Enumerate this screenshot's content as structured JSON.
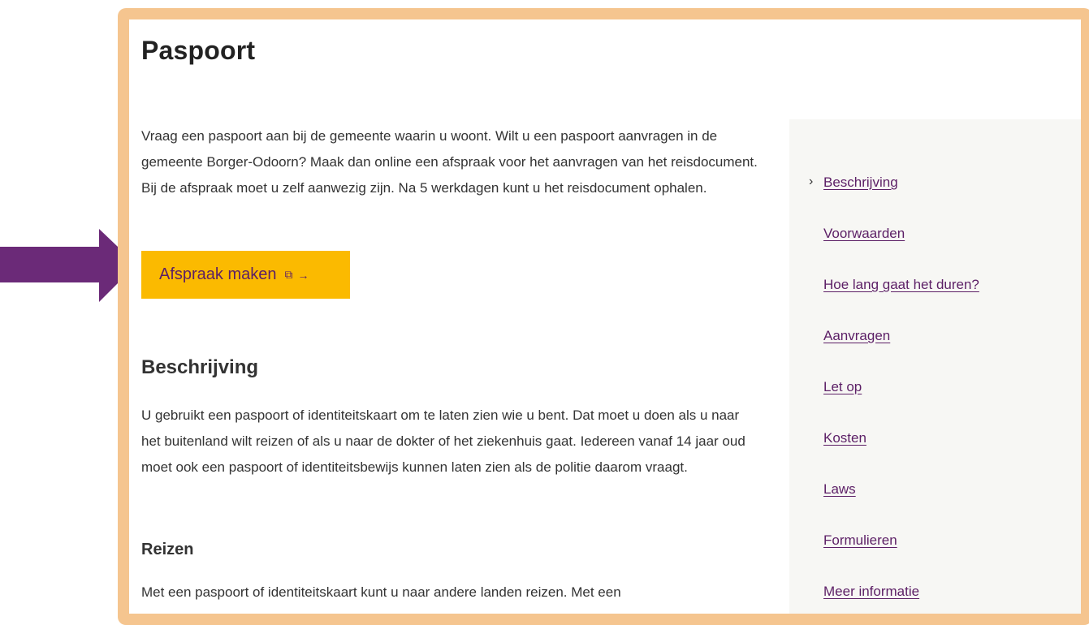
{
  "page": {
    "title": "Paspoort",
    "intro": "Vraag een paspoort aan bij de gemeente waarin u woont. Wilt u een paspoort aanvragen in de gemeente Borger-Odoorn? Maak dan online een afspraak voor het aanvragen van het reisdocument. Bij de afspraak moet u zelf aanwezig zijn. Na 5 werkdagen kunt u het reisdocument ophalen.",
    "cta_label": "Afspraak maken",
    "cta_icons": [
      "external-link-icon",
      "arrow-right-icon"
    ],
    "section_title": "Beschrijving",
    "section_text": "U gebruikt een paspoort of identiteitskaart om te laten zien wie u bent. Dat moet u doen als u naar het buitenland wilt reizen of als u naar de dokter of het ziekenhuis gaat. Iedereen vanaf 14 jaar oud moet ook een paspoort of identiteitsbewijs kunnen laten zien als de politie daarom vraagt.",
    "subsection_title": "Reizen",
    "subsection_text": "Met een paspoort of identiteitskaart kunt u naar andere landen reizen. Met een"
  },
  "toc": {
    "items": [
      {
        "label": "Beschrijving",
        "active": true
      },
      {
        "label": "Voorwaarden"
      },
      {
        "label": "Hoe lang gaat het duren?"
      },
      {
        "label": "Aanvragen"
      },
      {
        "label": "Let op"
      },
      {
        "label": "Kosten"
      },
      {
        "label": "Laws"
      },
      {
        "label": "Formulieren"
      },
      {
        "label": "Meer informatie"
      }
    ]
  },
  "colors": {
    "frame": "#f5c58f",
    "cta_bg": "#fbba00",
    "link": "#5c1f66",
    "pointer_arrow": "#6b2a78",
    "sidebar_bg": "#f7f7f4"
  }
}
